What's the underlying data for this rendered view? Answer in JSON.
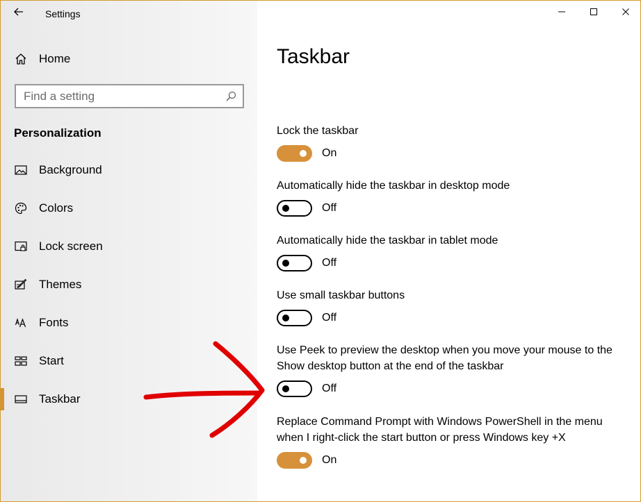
{
  "window": {
    "title": "Settings",
    "accent_color": "#d7913a"
  },
  "sidebar": {
    "home_label": "Home",
    "search_placeholder": "Find a setting",
    "section_heading": "Personalization",
    "items": [
      {
        "label": "Background",
        "icon": "picture-icon"
      },
      {
        "label": "Colors",
        "icon": "palette-icon"
      },
      {
        "label": "Lock screen",
        "icon": "lock-screen-icon"
      },
      {
        "label": "Themes",
        "icon": "themes-icon"
      },
      {
        "label": "Fonts",
        "icon": "fonts-icon"
      },
      {
        "label": "Start",
        "icon": "start-icon"
      },
      {
        "label": "Taskbar",
        "icon": "taskbar-icon",
        "selected": true
      }
    ]
  },
  "main": {
    "page_title": "Taskbar",
    "settings": [
      {
        "label": "Lock the taskbar",
        "state": "On"
      },
      {
        "label": "Automatically hide the taskbar in desktop mode",
        "state": "Off"
      },
      {
        "label": "Automatically hide the taskbar in tablet mode",
        "state": "Off"
      },
      {
        "label": "Use small taskbar buttons",
        "state": "Off"
      },
      {
        "label": "Use Peek to preview the desktop when you move your mouse to the Show desktop button at the end of the taskbar",
        "state": "Off"
      },
      {
        "label": "Replace Command Prompt with Windows PowerShell in the menu when I right-click the start button or press Windows key +X",
        "state": "On"
      }
    ]
  },
  "annotation": {
    "color": "#e00000"
  }
}
